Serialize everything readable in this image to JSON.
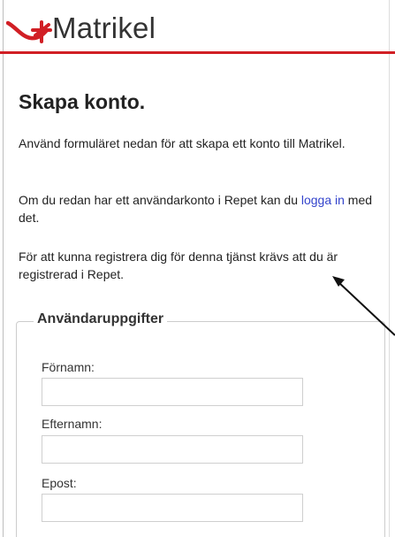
{
  "brand": {
    "logo_text": "Matrikel",
    "accent_color": "#d11f25",
    "link_color": "#3344cc"
  },
  "page": {
    "title": "Skapa konto.",
    "intro": "Använd formuläret nedan för att skapa ett konto till Matrikel.",
    "login_prefix": "Om du redan har ett användarkonto i Repet kan du ",
    "login_link": "logga in",
    "login_suffix": " med det.",
    "requirement": "För att kunna registrera dig för denna tjänst krävs att du är registrerad i Repet."
  },
  "form": {
    "legend": "Användaruppgifter",
    "fields": [
      {
        "label": "Förnamn:",
        "value": "",
        "placeholder": ""
      },
      {
        "label": "Efternamn:",
        "value": "",
        "placeholder": ""
      },
      {
        "label": "Epost:",
        "value": "",
        "placeholder": ""
      }
    ]
  },
  "icons": {
    "logo_mark": "matrikel-logo-icon",
    "annotation_arrow": "annotation-arrow-icon"
  }
}
